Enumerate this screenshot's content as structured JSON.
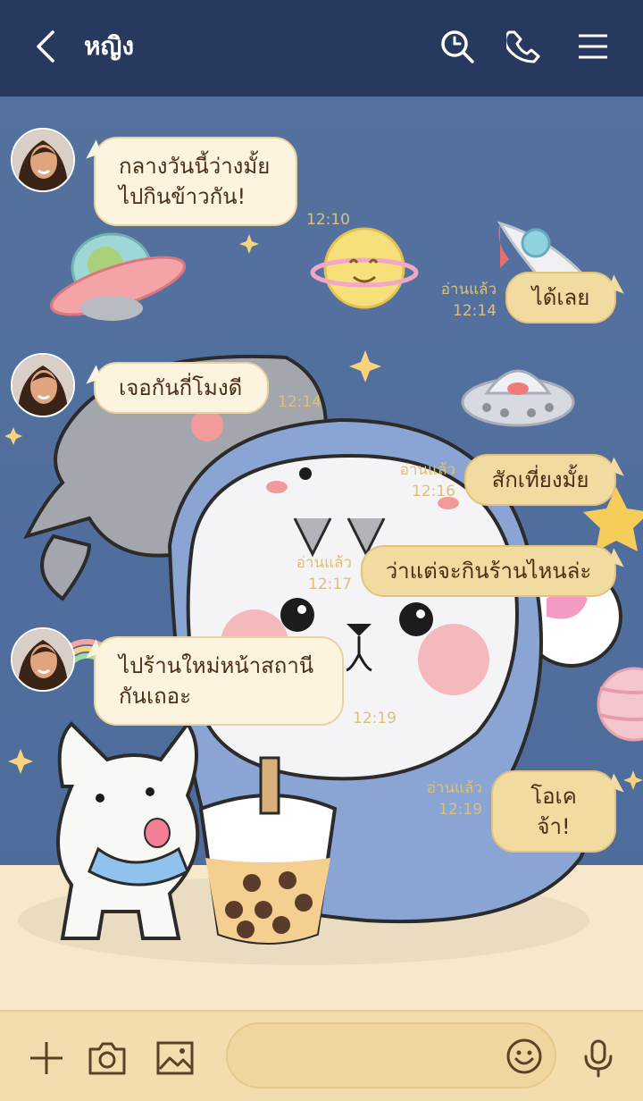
{
  "header": {
    "title": "หญิง",
    "icons": [
      "back-chevron-icon",
      "search-icon",
      "phone-icon",
      "menu-icon"
    ]
  },
  "messages": [
    {
      "side": "in",
      "text_lines": [
        "กลางวันนี้ว่างมั้ย",
        "ไปกินข้าวกัน!"
      ],
      "time": "12:10"
    },
    {
      "side": "out",
      "text": "ได้เลย",
      "read": "อ่านแล้ว",
      "time": "12:14"
    },
    {
      "side": "in",
      "text": "เจอกันกี่โมงดี",
      "time": "12:14"
    },
    {
      "side": "out",
      "text": "สักเที่ยงมั้ย",
      "read": "อ่านแล้ว",
      "time": "12:16"
    },
    {
      "side": "out",
      "text": "ว่าแต่จะกินร้านไหนล่ะ",
      "read": "อ่านแล้ว",
      "time": "12:17"
    },
    {
      "side": "in",
      "text_lines": [
        "ไปร้านใหม่หน้าสถานี",
        "กันเถอะ"
      ],
      "time": "12:19"
    },
    {
      "side": "out",
      "text": "โอเคจ้า!",
      "read": "อ่านแล้ว",
      "time": "12:19"
    }
  ],
  "footer": {
    "icons": [
      "plus-icon",
      "camera-icon",
      "image-icon",
      "emoji-icon",
      "microphone-icon"
    ],
    "input_value": ""
  },
  "colors": {
    "header_bg": "#27395f",
    "chat_bg": "#4a6a9a",
    "floor": "#f7e8cb",
    "bubble_in": "#fdf4e0",
    "bubble_out": "#f1dba0",
    "text": "#4a2f16",
    "meta": "#ddc078"
  }
}
